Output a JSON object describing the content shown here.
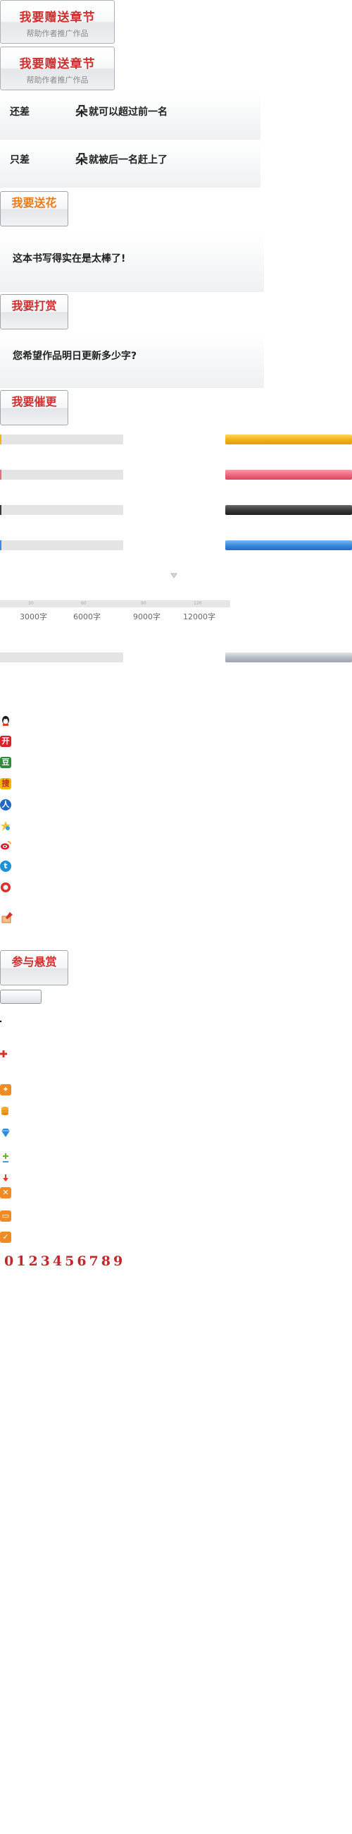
{
  "gift_buttons": [
    {
      "title": "我要赠送章节",
      "subtitle": "帮助作者推广作品"
    },
    {
      "title": "我要赠送章节",
      "subtitle": "帮助作者推广作品"
    }
  ],
  "rank_panels": [
    {
      "label": "还差",
      "flower_glyph": "朵",
      "text": "就可以超过前一名"
    },
    {
      "label": "只差",
      "flower_glyph": "朵",
      "text": "就被后一名赶上了"
    }
  ],
  "buttons": {
    "send_flower": "我要送花",
    "reward": "我要打赏",
    "urge": "我要催更",
    "bounty": "参与悬赏"
  },
  "panels": {
    "book_praise": "这本书写得实在是太棒了!",
    "update_question": "您希望作品明日更新多少字?"
  },
  "progress_bars": [
    {
      "name": "gold",
      "color": "#f2b21c",
      "fill": 0.01
    },
    {
      "name": "pink",
      "color": "#ec6b80",
      "fill": 0.01
    },
    {
      "name": "black",
      "color": "#3a3a3a",
      "fill": 0.01
    },
    {
      "name": "blue",
      "color": "#3d8be0",
      "fill": 0.01
    },
    {
      "name": "silver",
      "color": "#b8bcc6",
      "fill": 0.0
    }
  ],
  "word_scale": {
    "ticks": [
      "3000字",
      "6000字",
      "9000字",
      "12000字"
    ],
    "tick_marks": [
      "30",
      "60",
      "90",
      "120"
    ]
  },
  "share_icons": [
    {
      "name": "qq-icon",
      "color": "#1a1a1a"
    },
    {
      "name": "kaixin-icon",
      "color": "#d8232a"
    },
    {
      "name": "douban-icon",
      "color": "#2e8b3e"
    },
    {
      "name": "sohu-icon",
      "color": "#f1b800"
    },
    {
      "name": "renren-icon",
      "color": "#1f69c4"
    },
    {
      "name": "qzone-icon",
      "color": "#f2c230"
    },
    {
      "name": "weibo-icon",
      "color": "#e6162d"
    },
    {
      "name": "tqq-icon",
      "color": "#1e92d6"
    },
    {
      "name": "baidu-icon",
      "color": "#d9302c"
    }
  ],
  "misc_icons": [
    {
      "name": "gift-box-icon",
      "color": "#f08a24"
    },
    {
      "name": "coin-stack-icon",
      "color": "#f4a82d"
    },
    {
      "name": "diamond-icon",
      "color": "#2c8ad8"
    },
    {
      "name": "plus-small-icon",
      "color": "#5fb72b"
    },
    {
      "name": "minus-small-icon",
      "color": "#3aa0d8"
    },
    {
      "name": "down-arrow-icon",
      "color": "#e23b2e"
    },
    {
      "name": "close-box-icon",
      "color": "#f08a24"
    },
    {
      "name": "chat-box-icon",
      "color": "#f08a24"
    },
    {
      "name": "check-box-icon",
      "color": "#f08a24"
    }
  ],
  "digits": "0123456789"
}
